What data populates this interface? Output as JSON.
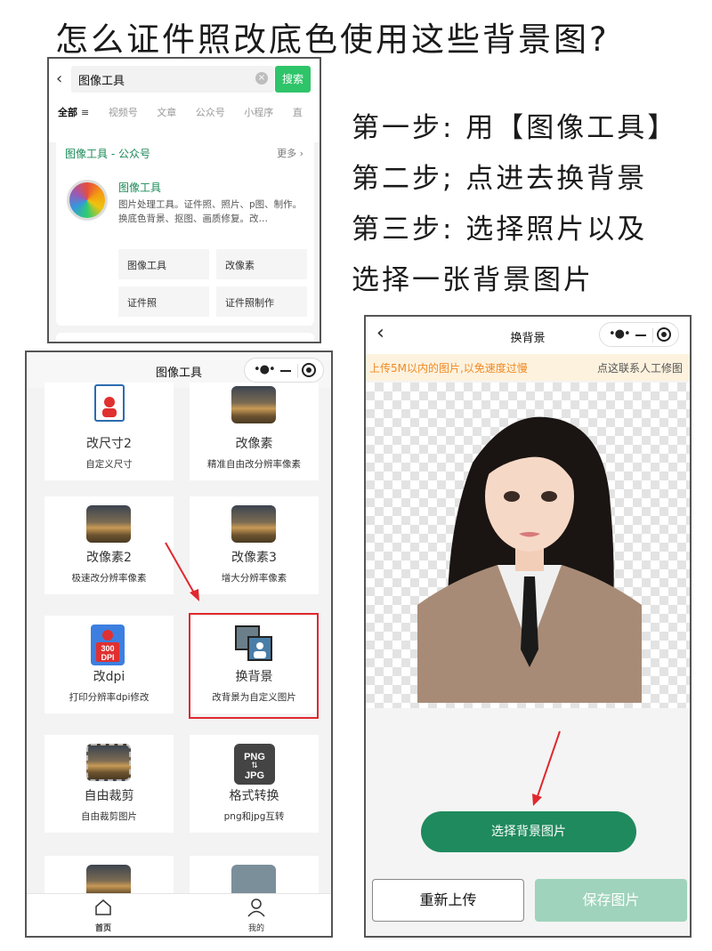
{
  "headline": "怎么证件照改底色使用这些背景图?",
  "steps": [
    "第一步: 用【图像工具】",
    "第二步; 点进去换背景",
    "第三步: 选择照片以及",
    "选择一张背景图片"
  ],
  "search_panel": {
    "query": "图像工具",
    "search_button": "搜索",
    "tabs": [
      "全部",
      "视频号",
      "文章",
      "公众号",
      "小程序",
      "直"
    ],
    "card_title": "图像工具 - 公众号",
    "more": "更多",
    "app_name": "图像工具",
    "app_desc": "图片处理工具。证件照、照片、p图、制作。换底色背景、抠图、画质修复。改…",
    "chips": [
      "图像工具",
      "改像素",
      "证件照",
      "证件照制作"
    ]
  },
  "tool_panel": {
    "title": "图像工具",
    "tiles": [
      {
        "name": "改尺寸2",
        "desc": "自定义尺寸",
        "icon": "resize-person-icon"
      },
      {
        "name": "改像素",
        "desc": "精准自由改分辨率像素",
        "icon": "pixel-landscape-icon"
      },
      {
        "name": "改像素2",
        "desc": "极速改分辨率像素",
        "icon": "pixel-landscape-icon"
      },
      {
        "name": "改像素3",
        "desc": "增大分辨率像素",
        "icon": "pixel-landscape-icon"
      },
      {
        "name": "改dpi",
        "desc": "打印分辨率dpi修改",
        "icon": "dpi-300-icon"
      },
      {
        "name": "换背景",
        "desc": "改背景为自定义图片",
        "icon": "change-background-icon"
      },
      {
        "name": "自由裁剪",
        "desc": "自由裁剪图片",
        "icon": "crop-icon"
      },
      {
        "name": "格式转换",
        "desc": "png和jpg互转",
        "icon": "png-jpg-icon"
      }
    ],
    "dpi_badge": "300\nDPI",
    "format_top": "PNG",
    "format_bottom": "JPG",
    "tabbar": [
      {
        "label": "首页",
        "icon": "home-icon"
      },
      {
        "label": "我的",
        "icon": "user-icon"
      }
    ]
  },
  "bg_panel": {
    "title": "换背景",
    "notice_left": "上传5M以内的图片,以免速度过慢",
    "notice_right": "点这联系人工修图",
    "choose_bg": "选择背景图片",
    "reupload": "重新上传",
    "save": "保存图片"
  },
  "colors": {
    "brand_green": "#1f8a5d",
    "search_green": "#2ec469",
    "highlight_red": "#e0282e",
    "notice_orange": "#f08a24"
  }
}
